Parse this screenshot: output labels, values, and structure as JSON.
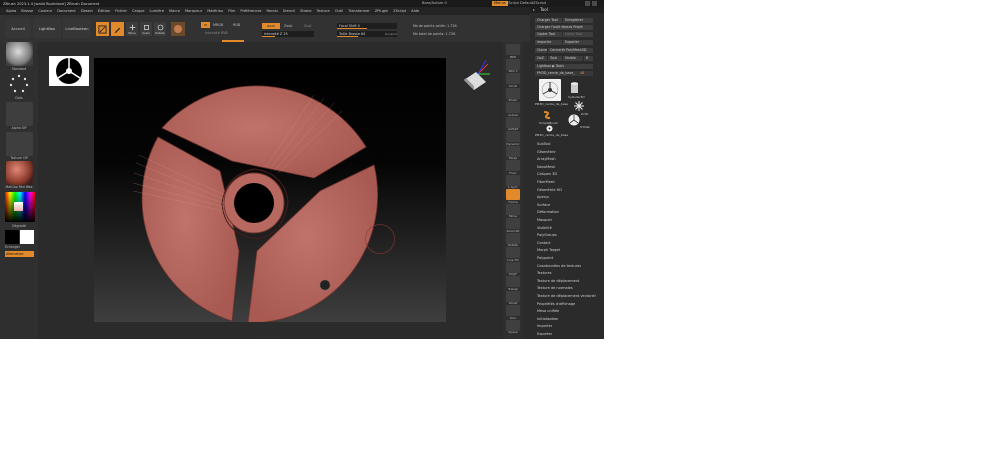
{
  "app": {
    "title": "ZBrush 2023.1.4 [walid Bouhdane]   ZBrush Document",
    "status_mid": "Fixed",
    "status_mid2": "Bare/Autom 0",
    "menus_button": "Menus",
    "zscript": "ZScript DefaultZScript"
  },
  "menubar": {
    "items": [
      "Alpha",
      "Brosse",
      "Couleur",
      "Document",
      "Dessin",
      "Édition",
      "Fichier",
      "Calque",
      "Lumière",
      "Macro",
      "Marqueur",
      "Matériau",
      "Film",
      "Préférences",
      "Rendu",
      "Stencil",
      "Stroke",
      "Texture",
      "Outil",
      "Transformer",
      "ZPlugin",
      "ZScript",
      "Aide"
    ]
  },
  "toolbar": {
    "home_label": "Accueil",
    "lightbox_label": "LightBox",
    "live_label": "LiveBoolean",
    "edit_label": "Edit",
    "draw_label": "Draw",
    "move_label": "Move",
    "scale_label": "Scale",
    "rotate_label": "Rotate",
    "mrgb": "MRGB",
    "rgb": "RGB",
    "m": "M",
    "rgb_intensity": "Intensité RVB",
    "zadd": "Zadd",
    "zsub": "Zsub",
    "zcut": "Zcut",
    "focal_shift": "Focal Shift 0",
    "draw_size": "Taille Brosse 64",
    "z_intensity": "Intensité Z 25",
    "dynamic": "Dynamic",
    "active_points": "Nb de points actifs: 1.726",
    "total_points": "Nb total de points: 1.726"
  },
  "left_shelf": {
    "brush_label": "Standard",
    "stroke_label": "Dots",
    "alpha_label": "Alpha Off",
    "texture_label": "Texture Off",
    "material_label": "MatCap Red Wax",
    "gradient_label": "Dégradé",
    "switch_label": "Échanger",
    "alternate_label": "Alternative"
  },
  "right_shelf": {
    "labels": [
      "BPR",
      "SPix 3",
      "Scroll",
      "Zoom",
      "Actual",
      "AAHalf",
      "Dynamic",
      "Persp",
      "Floor",
      "L.Sym",
      "Frame",
      "Move",
      "Zoom3D",
      "Rotate",
      "Line Fill",
      "PolyF",
      "Transp",
      "Ghost",
      "Solo",
      "Xpose"
    ]
  },
  "tool_panel": {
    "title": "Tool",
    "load_tool": "Charger Tool",
    "save_as": "Enregistrer",
    "load_project": "Charger l'outil depuis Projet",
    "copy_tool": "Copier Tool",
    "paste_tool": "Coller Tool",
    "import": "Importer",
    "export": "Exporter",
    "clone": "Cloner",
    "make_polymesh": "Convertir PolyMesh3D",
    "goz": "GoZ",
    "all": "Tout",
    "visible": "Visible",
    "r": "R",
    "lightbox_tools": "Lightbox ▶ Tools",
    "current_tool": "PM3D_cercle_de_base_",
    "current_value": "48",
    "tools": [
      {
        "name": "PM3D_cercle_de_base",
        "icon": "disc-tool-icon"
      },
      {
        "name": "Cylinder3D",
        "icon": "cylinder-tool-icon"
      },
      {
        "name": "SimpleBrush",
        "icon": "simplebrush-tool-icon"
      },
      {
        "name": "PolyMesh3D",
        "icon": "star-tool-icon"
      },
      {
        "name": "PM3D_cercle_de_base",
        "icon": "disc-tool-icon"
      },
      {
        "name": "TriDisk",
        "icon": "disc-tool-icon"
      }
    ],
    "subpalettes": [
      "SubTool",
      "Géométrie",
      "ArrayMesh",
      "NanoMesh",
      "Calques 3D",
      "FiberMesh",
      "Géométrie HD",
      "Aperçu",
      "Surface",
      "Déformation",
      "Masquer",
      "Visibilité",
      "PolyGroups",
      "Contact",
      "Morph Target",
      "Polypaint",
      "Coordonnées de textures",
      "Textures",
      "Texture de déplacement",
      "Texture de normales",
      "Texture de déplacement vectoriel",
      "Propriétés d'affichage",
      "Mesa unifiée",
      "Initialisation",
      "Importer",
      "Exporter"
    ]
  },
  "colors": {
    "accent": "#e08a2b",
    "background": "#2b2b2b",
    "model_fill": "#b5645b"
  }
}
